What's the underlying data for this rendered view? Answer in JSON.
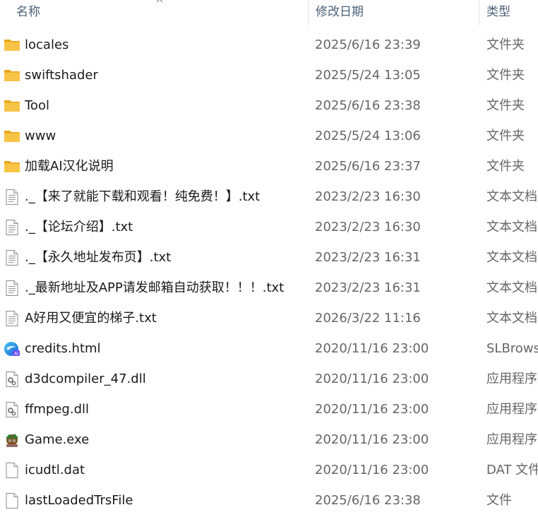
{
  "header": {
    "name_label": "名称",
    "date_label": "修改日期",
    "type_label": "类型"
  },
  "files": [
    {
      "name": "locales",
      "date": "2025/6/16 23:39",
      "type": "文件夹",
      "icon": "folder-icon"
    },
    {
      "name": "swiftshader",
      "date": "2025/5/24 13:05",
      "type": "文件夹",
      "icon": "folder-icon"
    },
    {
      "name": "Tool",
      "date": "2025/6/16 23:38",
      "type": "文件夹",
      "icon": "folder-icon"
    },
    {
      "name": "www",
      "date": "2025/5/24 13:06",
      "type": "文件夹",
      "icon": "folder-icon"
    },
    {
      "name": "加载AI汉化说明",
      "date": "2025/6/16 23:37",
      "type": "文件夹",
      "icon": "folder-icon"
    },
    {
      "name": "._【来了就能下载和观看！纯免费！】.txt",
      "date": "2023/2/23 16:30",
      "type": "文本文档",
      "icon": "text-file-icon"
    },
    {
      "name": "._【论坛介绍】.txt",
      "date": "2023/2/23 16:30",
      "type": "文本文档",
      "icon": "text-file-icon"
    },
    {
      "name": "._【永久地址发布页】.txt",
      "date": "2023/2/23 16:31",
      "type": "文本文档",
      "icon": "text-file-icon"
    },
    {
      "name": "._最新地址及APP请发邮箱自动获取！！！.txt",
      "date": "2023/2/23 16:31",
      "type": "文本文档",
      "icon": "text-file-icon"
    },
    {
      "name": "A好用又便宜的梯子.txt",
      "date": "2026/3/22 11:16",
      "type": "文本文档",
      "icon": "text-file-icon"
    },
    {
      "name": "credits.html",
      "date": "2020/11/16 23:00",
      "type": "SLBrowser",
      "icon": "browser-html-icon"
    },
    {
      "name": "d3dcompiler_47.dll",
      "date": "2020/11/16 23:00",
      "type": "应用程序扩展",
      "icon": "dll-file-icon"
    },
    {
      "name": "ffmpeg.dll",
      "date": "2020/11/16 23:00",
      "type": "应用程序扩展",
      "icon": "dll-file-icon"
    },
    {
      "name": "Game.exe",
      "date": "2020/11/16 23:00",
      "type": "应用程序",
      "icon": "game-exe-icon"
    },
    {
      "name": "icudtl.dat",
      "date": "2020/11/16 23:00",
      "type": "DAT 文件",
      "icon": "blank-file-icon"
    },
    {
      "name": "lastLoadedTrsFile",
      "date": "2025/6/16 23:38",
      "type": "文件",
      "icon": "blank-file-icon"
    }
  ],
  "colors": {
    "folder": "#f8c447",
    "folder_dark": "#e8a317",
    "header_text": "#4c607a",
    "name_text": "#1a1a1a",
    "meta_text": "#666666"
  }
}
